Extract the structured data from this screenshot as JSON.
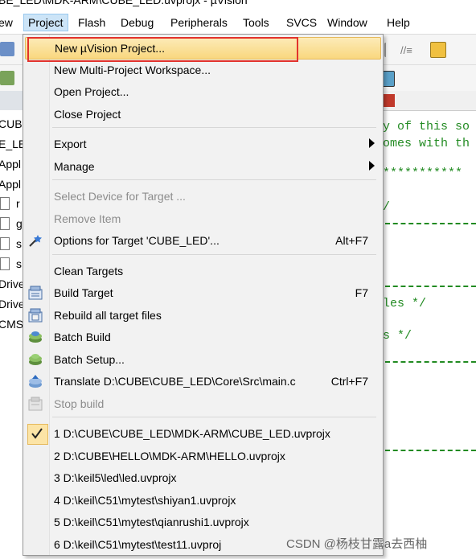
{
  "window": {
    "title": "BE_LED\\MDK-ARM\\CUBE_LED.uvprojx - µVision"
  },
  "menubar": {
    "items": [
      "ew",
      "Project",
      "Flash",
      "Debug",
      "Peripherals",
      "Tools",
      "SVCS",
      "Window",
      "Help"
    ],
    "active_index": 1
  },
  "left_panel": {
    "labels": [
      "CUBE",
      "E_LE",
      "Appl",
      "Appl",
      "r",
      "g",
      "s",
      "s",
      "Drive",
      "Drive",
      "CMS"
    ]
  },
  "editor": {
    "lines": [
      "y of this so",
      "omes with th",
      "***********",
      "/",
      "les */",
      "s */"
    ]
  },
  "project_menu": {
    "items": [
      {
        "label": "New µVision Project...",
        "shortcut": "",
        "icon": "",
        "state": "highlighted"
      },
      {
        "label": "New Multi-Project Workspace...",
        "shortcut": "",
        "icon": "",
        "state": "normal"
      },
      {
        "label": "Open Project...",
        "shortcut": "",
        "icon": "",
        "state": "normal"
      },
      {
        "label": "Close Project",
        "shortcut": "",
        "icon": "",
        "state": "normal"
      },
      {
        "label": "Export",
        "shortcut": "",
        "icon": "",
        "state": "submenu"
      },
      {
        "label": "Manage",
        "shortcut": "",
        "icon": "",
        "state": "submenu"
      },
      {
        "label": "Select Device for Target ...",
        "shortcut": "",
        "icon": "",
        "state": "disabled"
      },
      {
        "label": "Remove Item",
        "shortcut": "",
        "icon": "",
        "state": "disabled"
      },
      {
        "label": "Options for Target 'CUBE_LED'...",
        "shortcut": "Alt+F7",
        "icon": "options-wand-icon",
        "state": "normal"
      },
      {
        "label": "Clean Targets",
        "shortcut": "",
        "icon": "",
        "state": "normal"
      },
      {
        "label": "Build Target",
        "shortcut": "F7",
        "icon": "build-icon",
        "state": "normal"
      },
      {
        "label": "Rebuild all target files",
        "shortcut": "",
        "icon": "rebuild-icon",
        "state": "normal"
      },
      {
        "label": "Batch Build",
        "shortcut": "",
        "icon": "batch-build-icon",
        "state": "normal"
      },
      {
        "label": "Batch Setup...",
        "shortcut": "",
        "icon": "batch-setup-icon",
        "state": "normal"
      },
      {
        "label": "Translate D:\\CUBE\\CUBE_LED\\Core\\Src\\main.c",
        "shortcut": "Ctrl+F7",
        "icon": "translate-icon",
        "state": "normal"
      },
      {
        "label": "Stop build",
        "shortcut": "",
        "icon": "stop-build-icon",
        "state": "disabled"
      },
      {
        "label": "1 D:\\CUBE\\CUBE_LED\\MDK-ARM\\CUBE_LED.uvprojx",
        "shortcut": "",
        "icon": "check-icon",
        "state": "checked"
      },
      {
        "label": "2 D:\\CUBE\\HELLO\\MDK-ARM\\HELLO.uvprojx",
        "shortcut": "",
        "icon": "",
        "state": "normal"
      },
      {
        "label": "3 D:\\keil5\\led\\led.uvprojx",
        "shortcut": "",
        "icon": "",
        "state": "normal"
      },
      {
        "label": "4 D:\\keil\\C51\\mytest\\shiyan1.uvprojx",
        "shortcut": "",
        "icon": "",
        "state": "normal"
      },
      {
        "label": "5 D:\\keil\\C51\\mytest\\qianrushi1.uvprojx",
        "shortcut": "",
        "icon": "",
        "state": "normal"
      },
      {
        "label": "6 D:\\keil\\C51\\mytest\\test11.uvproj",
        "shortcut": "",
        "icon": "",
        "state": "normal"
      }
    ]
  },
  "watermark": {
    "text": "CSDN @杨枝甘露a去西柚"
  },
  "colors": {
    "highlight": "#f9d77e",
    "annotation_box": "#e2322c",
    "code_comment": "#228b22",
    "menu_bg": "#f2f2f2"
  }
}
